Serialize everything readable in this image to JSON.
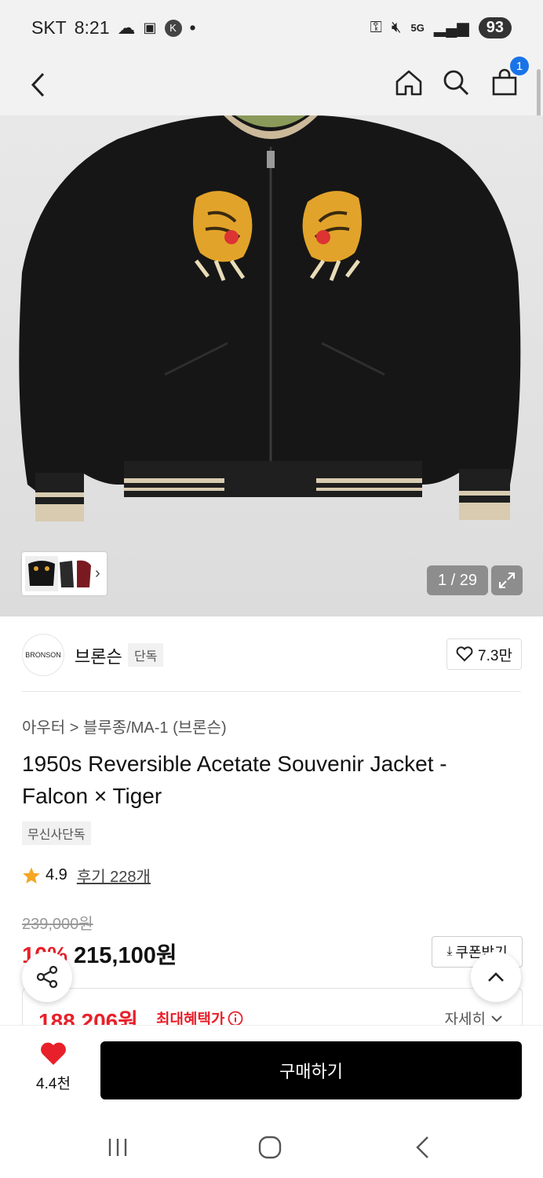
{
  "status": {
    "carrier": "SKT",
    "time": "8:21",
    "network": "5G",
    "battery": "93"
  },
  "header": {
    "cart_count": "1"
  },
  "gallery": {
    "counter": "1 / 29"
  },
  "brand": {
    "logo_text": "BRONSON",
    "name": "브론슨",
    "tag": "단독",
    "likes": "7.3만"
  },
  "product": {
    "breadcrumb": "아우터 > 블루종/MA-1 (브론슨)",
    "title": "1950s Reversible Acetate Souvenir Jacket - Falcon × Tiger",
    "exclusive_badge": "무신사단독",
    "rating": "4.9",
    "review_label": "후기 228개",
    "original_price": "239,000원",
    "discount": "10%",
    "sale_price": "215,100원",
    "coupon_label": "쿠폰받기",
    "max_benefit_price": "188,206원",
    "max_benefit_label": "최대혜택가",
    "detail_label": "자세히"
  },
  "bottom": {
    "heart_count": "4.4천",
    "buy_label": "구매하기"
  },
  "colors": {
    "accent_red": "#e8202a",
    "badge_blue": "#1a73e8",
    "buy_bg": "#000000"
  }
}
